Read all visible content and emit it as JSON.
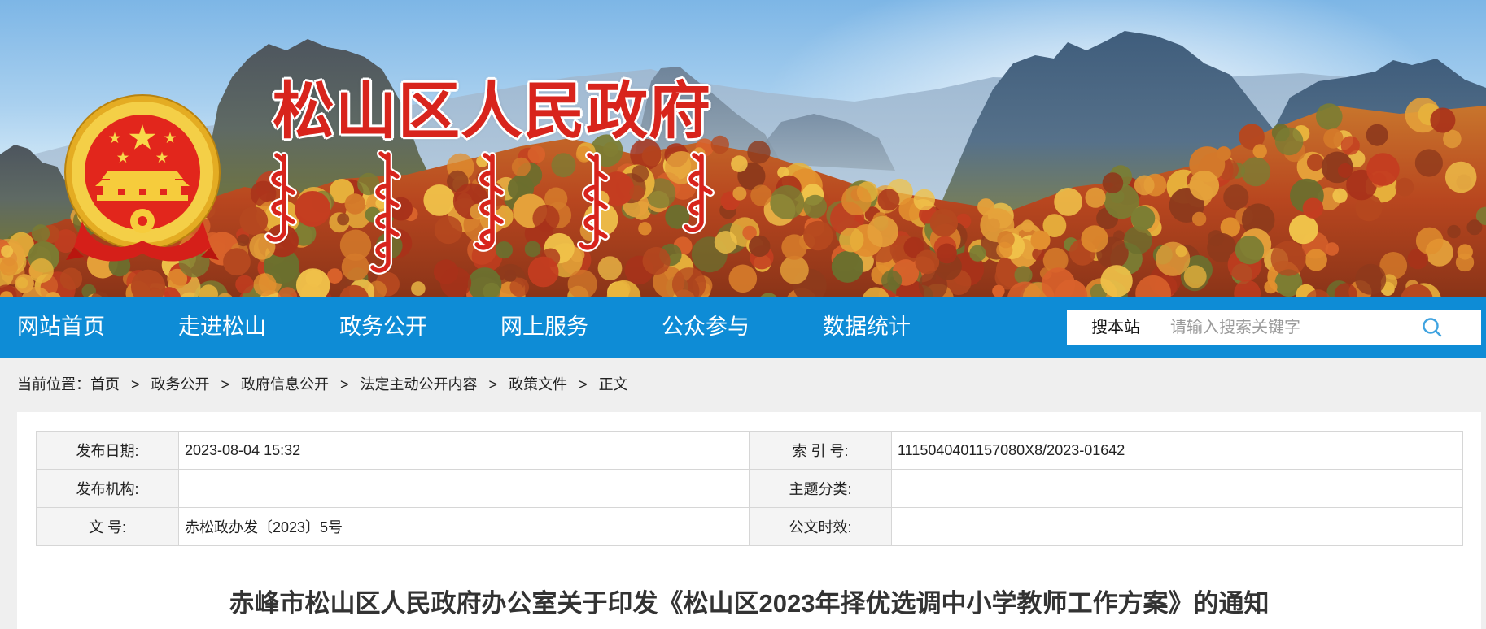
{
  "banner": {
    "site_title": "松山区人民政府",
    "emblem_icon": "national-emblem-icon"
  },
  "nav": {
    "items": [
      {
        "label": "网站首页"
      },
      {
        "label": "走进松山"
      },
      {
        "label": "政务公开"
      },
      {
        "label": "网上服务"
      },
      {
        "label": "公众参与"
      },
      {
        "label": "数据统计"
      }
    ]
  },
  "search": {
    "scope_label": "搜本站",
    "placeholder": "请输入搜索关键字",
    "icon": "search-icon"
  },
  "breadcrumb": {
    "prefix": "当前位置：",
    "separator": ">",
    "items": [
      "首页",
      "政务公开",
      "政府信息公开",
      "法定主动公开内容",
      "政策文件",
      "正文"
    ]
  },
  "info_table": {
    "rows": [
      {
        "label_left": "发布日期:",
        "value_left": "2023-08-04 15:32",
        "label_right": "索 引 号:",
        "value_right": "1115040401157080X8/2023-01642"
      },
      {
        "label_left": "发布机构:",
        "value_left": "",
        "label_right": "主题分类:",
        "value_right": ""
      },
      {
        "label_left": "文 号:",
        "value_left": "赤松政办发〔2023〕5号",
        "label_right": "公文时效:",
        "value_right": ""
      }
    ]
  },
  "article": {
    "title": "赤峰市松山区人民政府办公室关于印发《松山区2023年择优选调中小学教师工作方案》的通知"
  },
  "colors": {
    "nav_background": "#0e8cd6",
    "site_title_red": "#d8241c",
    "page_background": "#efefef"
  }
}
